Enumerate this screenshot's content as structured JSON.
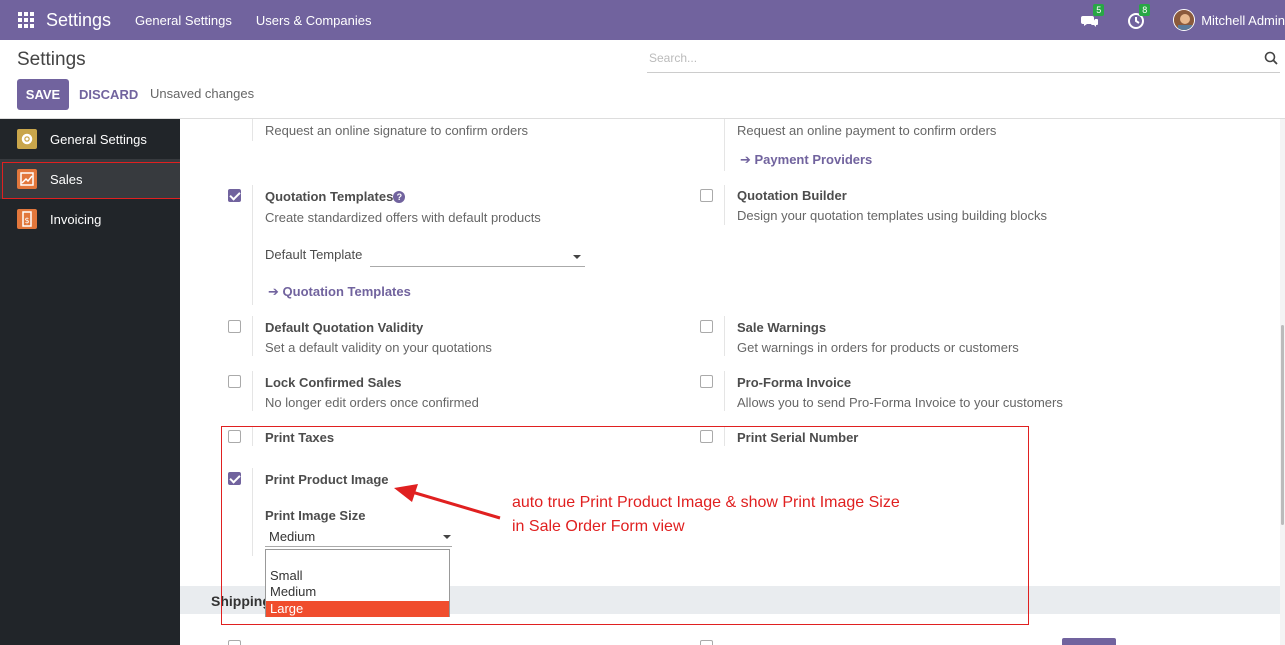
{
  "navbar": {
    "app_title": "Settings",
    "menu": [
      "General Settings",
      "Users & Companies"
    ],
    "messages_count": "5",
    "activities_count": "8",
    "user_name": "Mitchell Admin"
  },
  "control": {
    "title": "Settings",
    "save_label": "SAVE",
    "discard_label": "DISCARD",
    "status": "Unsaved changes",
    "search_placeholder": "Search..."
  },
  "sidebar": {
    "items": [
      {
        "label": "General Settings",
        "icon": "gear-icon",
        "color": "#c9a64b"
      },
      {
        "label": "Sales",
        "icon": "chart-icon",
        "color": "#e2773c",
        "active": true
      },
      {
        "label": "Invoicing",
        "icon": "invoice-icon",
        "color": "#e2773c"
      }
    ]
  },
  "settings": {
    "signature_desc": "Request an online signature to confirm orders",
    "payment_desc": "Request an online payment to confirm orders",
    "payment_link": "Payment Providers",
    "quotation_templates": {
      "label": "Quotation Templates",
      "desc": "Create standardized offers with default products",
      "default_template_label": "Default Template",
      "link": "Quotation Templates",
      "checked": true
    },
    "quotation_builder": {
      "label": "Quotation Builder",
      "desc": "Design your quotation templates using building blocks",
      "checked": false
    },
    "default_validity": {
      "label": "Default Quotation Validity",
      "desc": "Set a default validity on your quotations",
      "checked": false
    },
    "sale_warnings": {
      "label": "Sale Warnings",
      "desc": "Get warnings in orders for products or customers",
      "checked": false
    },
    "lock_confirmed": {
      "label": "Lock Confirmed Sales",
      "desc": "No longer edit orders once confirmed",
      "checked": false
    },
    "pro_forma": {
      "label": "Pro-Forma Invoice",
      "desc": "Allows you to send Pro-Forma Invoice to your customers",
      "checked": false
    },
    "print_taxes": {
      "label": "Print Taxes",
      "checked": false
    },
    "print_serial": {
      "label": "Print Serial Number",
      "checked": false
    },
    "print_product_image": {
      "label": "Print Product Image",
      "checked": true
    },
    "print_image_size": {
      "label": "Print Image Size",
      "value": "Medium",
      "options": [
        "Small",
        "Medium",
        "Large"
      ],
      "highlighted": "Large"
    },
    "shipping_section": "Shipping"
  },
  "annotation": {
    "line1": "auto true Print Product Image & show Print Image Size",
    "line2": "in Sale Order Form view"
  },
  "colors": {
    "brand": "#71639e",
    "annotation": "#e02020",
    "dropdown_highlight": "#f04d2d"
  }
}
